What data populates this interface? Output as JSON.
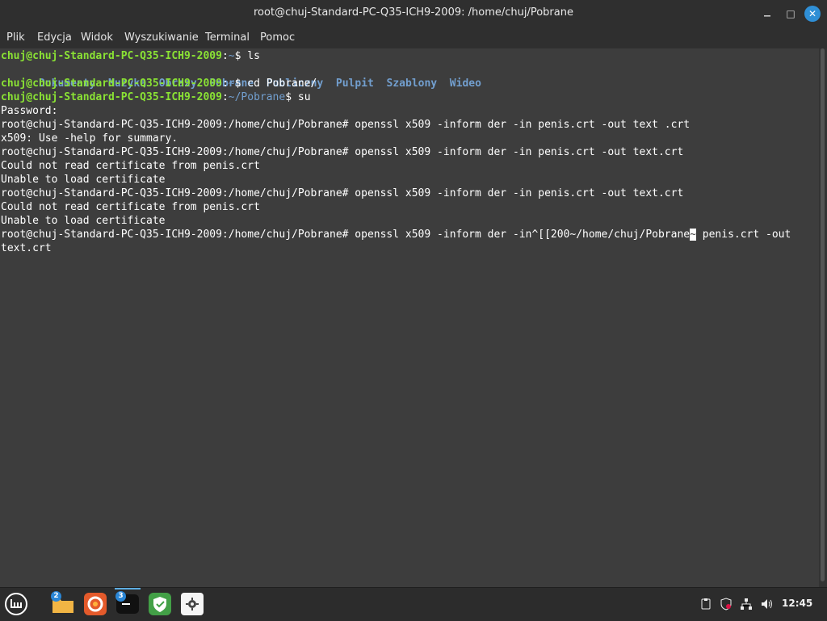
{
  "window": {
    "title": "root@chuj-Standard-PC-Q35-ICH9-2009: /home/chuj/Pobrane",
    "buttons": {
      "minimize": "",
      "maximize": "□",
      "close": "✕"
    }
  },
  "menu": [
    "Plik",
    "Edycja",
    "Widok",
    "Wyszukiwanie",
    "Terminal",
    "Pomoc"
  ],
  "terminal": {
    "prompt1": {
      "user": "chuj@chuj-Standard-PC-Q35-ICH9-2009",
      "path": "~",
      "cmd": "$ ls"
    },
    "dirs": [
      "Dokumenty",
      "Muzyka",
      "Obrazy",
      "Pobrane",
      "Publiczny",
      "Pulpit",
      "Szablony",
      "Wideo"
    ],
    "prompt2": {
      "user": "chuj@chuj-Standard-PC-Q35-ICH9-2009",
      "path": "~",
      "cmd": "$ cd Pobrane/"
    },
    "prompt3": {
      "user": "chuj@chuj-Standard-PC-Q35-ICH9-2009",
      "path": "~/Pobrane",
      "cmd": "$ su"
    },
    "lines": [
      "Password:",
      "root@chuj-Standard-PC-Q35-ICH9-2009:/home/chuj/Pobrane# openssl x509 -inform der -in penis.crt -out text .crt",
      "x509: Use -help for summary.",
      "root@chuj-Standard-PC-Q35-ICH9-2009:/home/chuj/Pobrane# openssl x509 -inform der -in penis.crt -out text.crt",
      "Could not read certificate from penis.crt",
      "Unable to load certificate",
      "root@chuj-Standard-PC-Q35-ICH9-2009:/home/chuj/Pobrane# openssl x509 -inform der -in penis.crt -out text.crt",
      "Could not read certificate from penis.crt",
      "Unable to load certificate"
    ],
    "last_line": {
      "before_cursor": "root@chuj-Standard-PC-Q35-ICH9-2009:/home/chuj/Pobrane# openssl x509 -inform der -in^[[200~/home/chuj/Pobrane",
      "cursor": "~",
      "after_cursor": " penis.crt -out",
      "wrap": "text.crt"
    }
  },
  "taskbar": {
    "items": [
      {
        "name": "menu-icon",
        "badge": ""
      },
      {
        "name": "files-icon",
        "badge": "2"
      },
      {
        "name": "firefox-icon",
        "badge": ""
      },
      {
        "name": "terminal-icon",
        "badge": "3"
      },
      {
        "name": "shield-icon",
        "badge": ""
      },
      {
        "name": "settings-icon",
        "badge": ""
      }
    ],
    "clock": "12:45"
  }
}
